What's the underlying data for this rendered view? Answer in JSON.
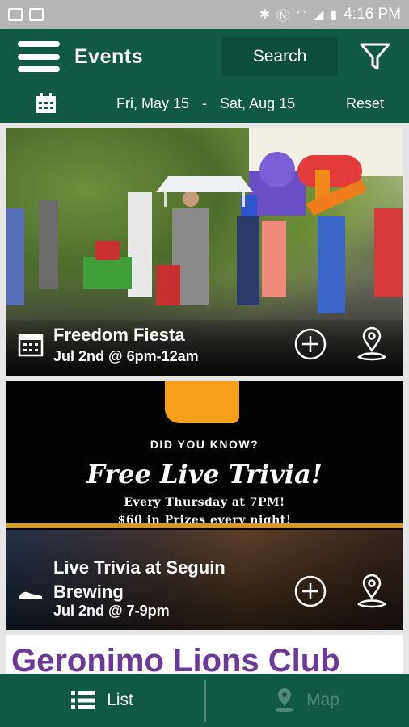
{
  "status_bar": {
    "time": "4:16 PM"
  },
  "header": {
    "title": "Events",
    "search_label": "Search"
  },
  "date_bar": {
    "start": "Fri, May 15",
    "separator": "-",
    "end": "Sat, Aug 15",
    "reset_label": "Reset"
  },
  "events": [
    {
      "title": "Freedom Fiesta",
      "when": "Jul 2nd @ 6pm-12am",
      "type_icon": "calendar-icon"
    },
    {
      "title": "Live Trivia at Seguin Brewing",
      "when": "Jul 2nd @ 7-9pm",
      "type_icon": "shoe-icon",
      "flyer": {
        "line1": "DID YOU KNOW?",
        "line2": "Free Live Trivia!",
        "line3": "Every Thursday at 7PM!",
        "line4": "$60 in Prizes every night!"
      }
    },
    {
      "title": "Geronimo Lions Club"
    }
  ],
  "bottom_nav": {
    "list_label": "List",
    "map_label": "Map"
  },
  "colors": {
    "primary": "#0f5945",
    "dark": "#0b4d3b",
    "inactive": "#4f8a77",
    "lions_purple": "#6b3a98"
  }
}
